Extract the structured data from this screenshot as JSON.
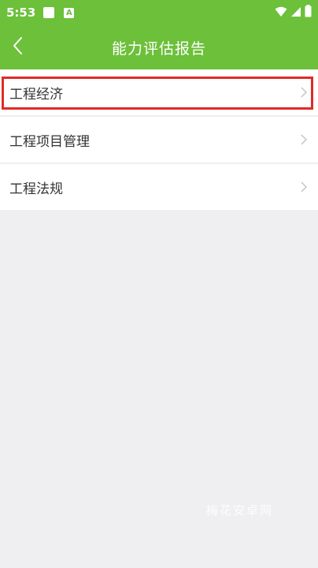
{
  "status_bar": {
    "time": "5:53",
    "notification_badge_text": "A",
    "icons": [
      "wifi-icon",
      "cell-signal-icon",
      "battery-icon"
    ]
  },
  "app_bar": {
    "title": "能力评估报告",
    "back_icon": "chevron-left-icon"
  },
  "list": {
    "items": [
      {
        "label": "工程经济",
        "highlighted": true
      },
      {
        "label": "工程项目管理",
        "highlighted": false
      },
      {
        "label": "工程法规",
        "highlighted": false
      }
    ],
    "chevron_icon": "chevron-right-icon"
  },
  "watermark": "梅花安卓网",
  "colors": {
    "accent": "#6cc03a",
    "background": "#efeff1",
    "highlight": "#e02b27",
    "item_text": "#333333"
  }
}
